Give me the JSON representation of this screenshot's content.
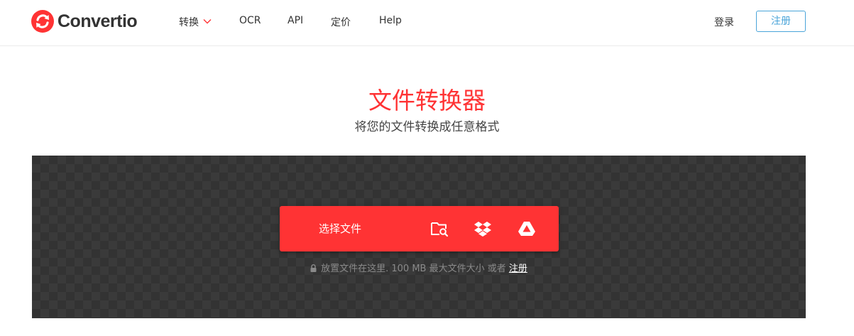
{
  "header": {
    "brand": "Convertio",
    "nav": [
      {
        "label": "转换",
        "icon": "chevron-down-icon"
      },
      {
        "label": "OCR"
      },
      {
        "label": "API"
      },
      {
        "label": "定价"
      },
      {
        "label": "Help"
      }
    ],
    "login_label": "登录",
    "signup_label": "注册"
  },
  "hero": {
    "title": "文件转换器",
    "subtitle": "将您的文件转换成任意格式"
  },
  "uploader": {
    "choose_label": "选择文件",
    "sources": [
      {
        "icon": "folder-search-icon"
      },
      {
        "icon": "dropbox-icon"
      },
      {
        "icon": "google-drive-icon"
      }
    ],
    "hint_text": "放置文件在这里. 100 MB 最大文件大小 或者",
    "hint_link": "注册",
    "hint_icon": "lock-icon"
  },
  "colors": {
    "accent": "#ff3334",
    "link_blue": "#4aa4d9",
    "dropzone_bg": "#333333"
  }
}
